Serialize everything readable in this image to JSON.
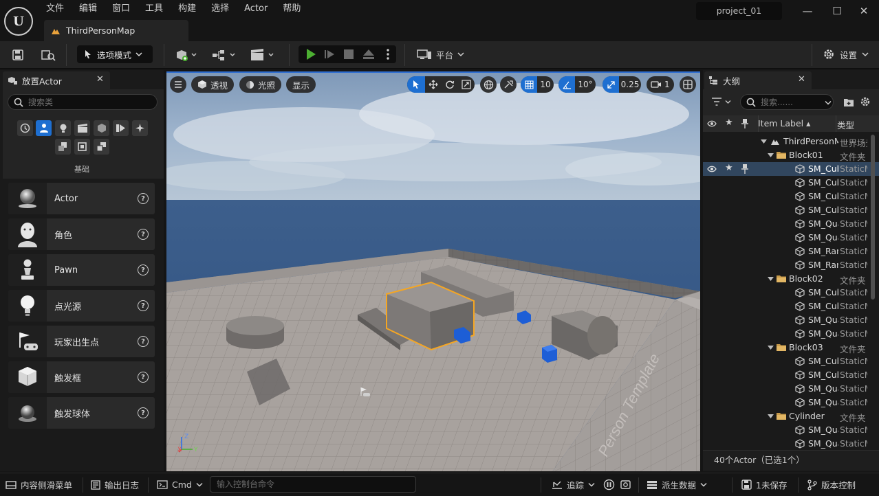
{
  "menu": [
    "文件",
    "编辑",
    "窗口",
    "工具",
    "构建",
    "选择",
    "Actor",
    "帮助"
  ],
  "map_tab": "ThirdPersonMap",
  "project_name": "project_01",
  "toolbar": {
    "mode_label": "选项模式",
    "platform_label": "平台",
    "settings_label": "设置"
  },
  "place_actor": {
    "tab_title": "放置Actor",
    "search_placeholder": "搜索类",
    "category_label": "基础",
    "items": [
      "Actor",
      "角色",
      "Pawn",
      "点光源",
      "玩家出生点",
      "触发框",
      "触发球体"
    ]
  },
  "viewport": {
    "perspective": "透视",
    "lighting": "光照",
    "show": "显示",
    "grid_snap": "10",
    "rot_snap": "10°",
    "scale_snap": "0.25",
    "camera_speed": "1",
    "floor_text": "Person Template"
  },
  "outliner": {
    "tab_title": "大纲",
    "search_placeholder": "搜索......",
    "col_label": "Item Label ▴",
    "col_type": "类型",
    "rows": [
      {
        "label": "ThirdPersonMap",
        "type": "世界场景",
        "indent": 0,
        "kind": "world"
      },
      {
        "label": "Block01",
        "type": "文件夹",
        "indent": 1,
        "kind": "folder"
      },
      {
        "label": "SM_Cube",
        "type": "StaticMesh",
        "indent": 2,
        "kind": "mesh",
        "selected": true
      },
      {
        "label": "SM_Cube",
        "type": "StaticMesh",
        "indent": 2,
        "kind": "mesh"
      },
      {
        "label": "SM_Cube",
        "type": "StaticMesh",
        "indent": 2,
        "kind": "mesh"
      },
      {
        "label": "SM_Cube",
        "type": "StaticMesh",
        "indent": 2,
        "kind": "mesh"
      },
      {
        "label": "SM_Quad",
        "type": "StaticMesh",
        "indent": 2,
        "kind": "mesh"
      },
      {
        "label": "SM_Quad",
        "type": "StaticMesh",
        "indent": 2,
        "kind": "mesh"
      },
      {
        "label": "SM_Ramp",
        "type": "StaticMesh",
        "indent": 2,
        "kind": "mesh"
      },
      {
        "label": "SM_Ramp",
        "type": "StaticMesh",
        "indent": 2,
        "kind": "mesh"
      },
      {
        "label": "Block02",
        "type": "文件夹",
        "indent": 1,
        "kind": "folder"
      },
      {
        "label": "SM_Cube",
        "type": "StaticMesh",
        "indent": 2,
        "kind": "mesh"
      },
      {
        "label": "SM_Cube",
        "type": "StaticMesh",
        "indent": 2,
        "kind": "mesh"
      },
      {
        "label": "SM_Quad",
        "type": "StaticMesh",
        "indent": 2,
        "kind": "mesh"
      },
      {
        "label": "SM_Quad",
        "type": "StaticMesh",
        "indent": 2,
        "kind": "mesh"
      },
      {
        "label": "Block03",
        "type": "文件夹",
        "indent": 1,
        "kind": "folder"
      },
      {
        "label": "SM_Cube",
        "type": "StaticMesh",
        "indent": 2,
        "kind": "mesh"
      },
      {
        "label": "SM_Cube",
        "type": "StaticMesh",
        "indent": 2,
        "kind": "mesh"
      },
      {
        "label": "SM_Quad",
        "type": "StaticMesh",
        "indent": 2,
        "kind": "mesh"
      },
      {
        "label": "SM_Quad",
        "type": "StaticMesh",
        "indent": 2,
        "kind": "mesh"
      },
      {
        "label": "Cylinder",
        "type": "文件夹",
        "indent": 1,
        "kind": "folder"
      },
      {
        "label": "SM_Quad",
        "type": "StaticMesh",
        "indent": 2,
        "kind": "mesh"
      },
      {
        "label": "SM_Quad",
        "type": "StaticMesh",
        "indent": 2,
        "kind": "mesh"
      }
    ],
    "footer": "40个Actor（已选1个）"
  },
  "statusbar": {
    "content_drawer": "内容侧滑菜单",
    "output_log": "输出日志",
    "cmd": "Cmd",
    "cmd_placeholder": "输入控制台命令",
    "trace": "追踪",
    "derived_data": "派生数据",
    "unsaved": "1未保存",
    "source_control": "版本控制"
  },
  "colors": {
    "accent": "#1e6fd1",
    "play": "#4caf32",
    "selection": "#f5a623"
  }
}
